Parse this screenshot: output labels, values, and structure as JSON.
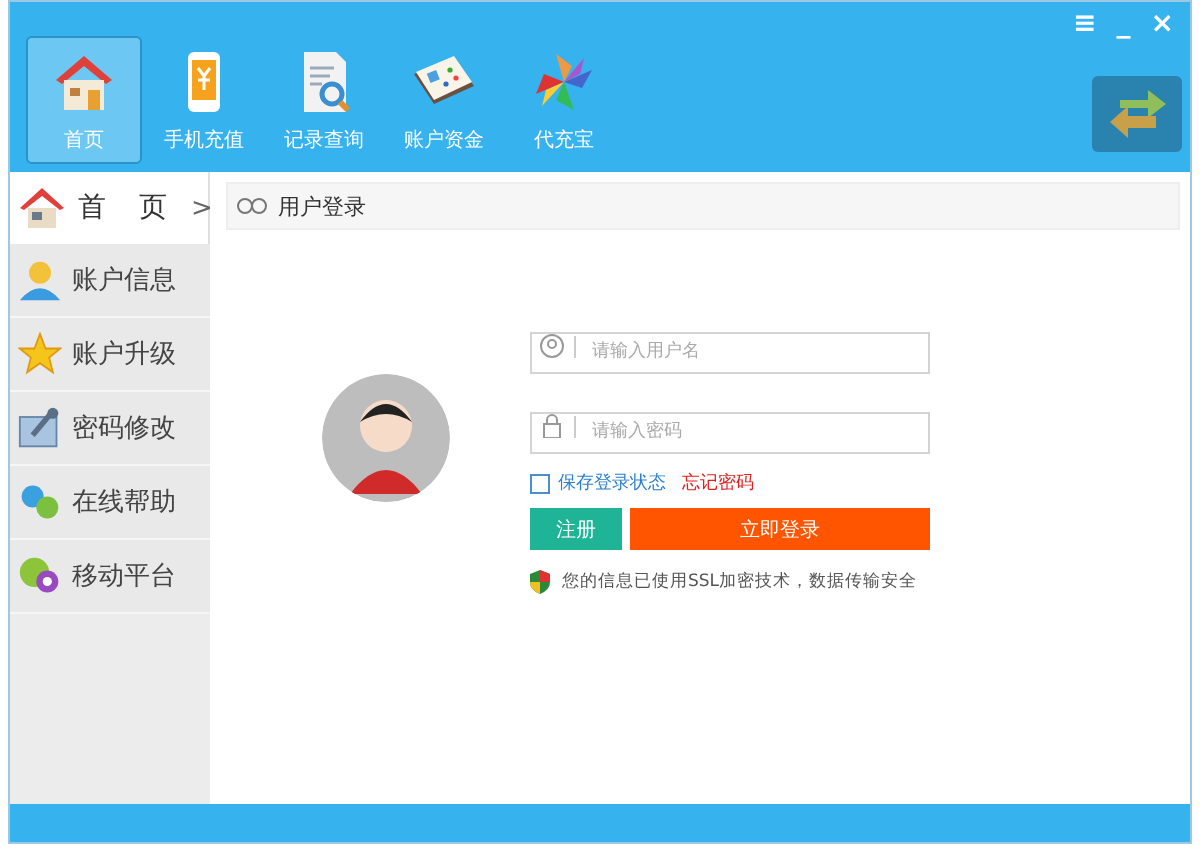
{
  "window": {
    "controls": [
      "≡",
      "_",
      "×"
    ]
  },
  "toolbar": [
    {
      "label": "首页",
      "selected": true
    },
    {
      "label": "手机充值",
      "selected": false
    },
    {
      "label": "记录查询",
      "selected": false
    },
    {
      "label": "账户资金",
      "selected": false
    },
    {
      "label": "代充宝",
      "selected": false
    }
  ],
  "sidebar": {
    "home": {
      "label": "首 页",
      "arrow": ">"
    },
    "items": [
      {
        "label": "账户信息"
      },
      {
        "label": "账户升级"
      },
      {
        "label": "密码修改"
      },
      {
        "label": "在线帮助"
      },
      {
        "label": "移动平台"
      }
    ]
  },
  "breadcrumb": {
    "title": "用户登录"
  },
  "login": {
    "username": {
      "placeholder": "请输入用户名"
    },
    "password": {
      "placeholder": "请输入密码"
    },
    "remember": {
      "label": "保存登录状态",
      "checked": false
    },
    "forgot": "忘记密码",
    "register": "注册",
    "submit": "立即登录",
    "notice": "您的信息已使用SSL加密技术，数据传输安全"
  }
}
